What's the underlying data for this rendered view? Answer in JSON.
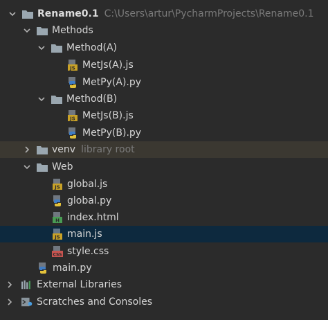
{
  "project": {
    "name": "Rename0.1",
    "path": "C:\\Users\\artur\\PycharmProjects\\Rename0.1"
  },
  "methods": {
    "label": "Methods",
    "a": {
      "label": "Method(A)",
      "files": [
        "MetJs(A).js",
        "MetPy(A).py"
      ]
    },
    "b": {
      "label": "Method(B)",
      "files": [
        "MetJs(B).js",
        "MetPy(B).py"
      ]
    }
  },
  "venv": {
    "label": "venv",
    "hint": "library root"
  },
  "web": {
    "label": "Web",
    "files": [
      "global.js",
      "global.py",
      "index.html",
      "main.js",
      "style.css"
    ]
  },
  "root_files": [
    "main.py"
  ],
  "external_libraries": "External Libraries",
  "scratches": "Scratches and Consoles",
  "colors": {
    "background": "#2b2b2b",
    "selection": "#0d293e",
    "venv_highlight": "#3b3831",
    "folder": "#9aa7b0"
  }
}
